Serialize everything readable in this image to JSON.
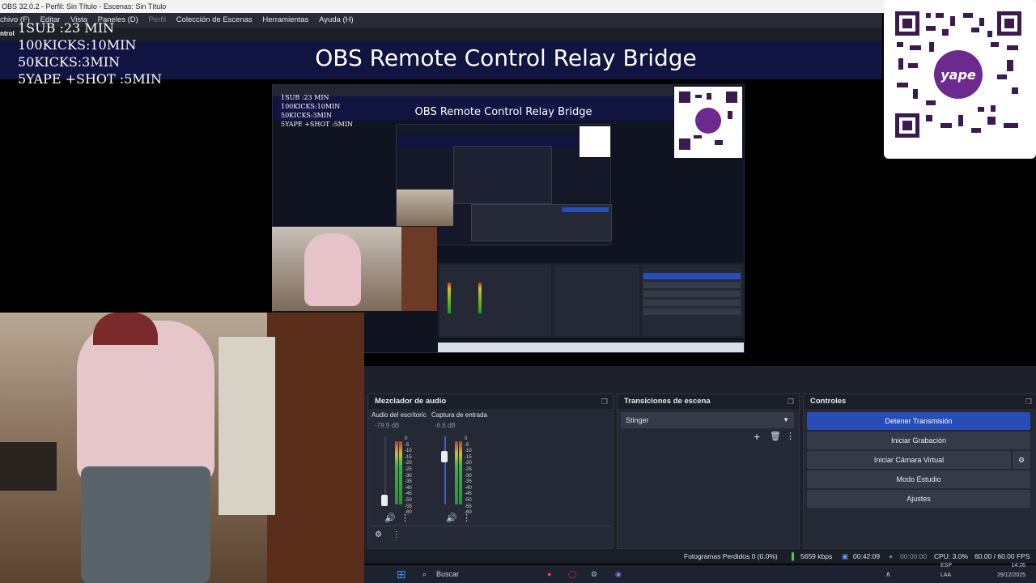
{
  "window": {
    "title": "OBS 32.0.2 - Perfil: Sin Título - Escenas: Sin Título"
  },
  "menu": {
    "items": [
      "chivo (F)",
      "Editar",
      "Vista",
      "Paneles (D)",
      "Perfil",
      "Colección de Escenas",
      "Herramientas",
      "Ayuda (H)"
    ]
  },
  "control_strip": {
    "label": "ntrol"
  },
  "overlay": {
    "banner_title": "OBS Remote Control Relay Bridge",
    "lines": [
      "1SUB :23 MIN",
      "100KICKS:10MIN",
      "50KICKS:3MIN",
      "5YAPE +SHOT :5MIN"
    ]
  },
  "qr": {
    "label": "yape"
  },
  "audio_mixer": {
    "title": "Mezclador de audio",
    "channels": [
      {
        "name": "Audio del escritoric",
        "db": "-79.9 dB",
        "level": 0.45
      },
      {
        "name": "Captura de entrada",
        "db": "-6.6 dB",
        "level": 0.8
      }
    ],
    "scale": [
      "0",
      "-5",
      "-10",
      "-15",
      "-20",
      "-25",
      "-30",
      "-35",
      "-40",
      "-45",
      "-50",
      "-55",
      "-60"
    ]
  },
  "transitions": {
    "title": "Transiciones de escena",
    "selected": "Stinger"
  },
  "controls": {
    "title": "Controles",
    "buttons": [
      "Detener Transmisión",
      "Iniciar Grabación",
      "Iniciar Cámara Virtual",
      "Modo Estudio",
      "Ajustes"
    ]
  },
  "status": {
    "dropped": "Fotogramas Perdidos 0 (0.0%)",
    "bitrate": "5659 kbps",
    "stream_time": "00:42:09",
    "rec_time": "00:00:00",
    "cpu": "CPU: 3.0%",
    "fps": "60.00 / 60.00 FPS"
  },
  "taskbar": {
    "search": "Buscar",
    "lang": "ESP",
    "lang2": "LAA",
    "time": "14:26",
    "date": "29/12/2025"
  },
  "preview": {
    "title": "OBS Remote Control Relay Bridge",
    "lines": [
      "1SUB :23 MIN",
      "100KICKS:10MIN",
      "50KICKS:3MIN",
      "5YAPE +SHOT :5MIN"
    ]
  },
  "colors": {
    "banner": "#0f1440",
    "primary_button": "#284cb8",
    "panel": "#252935"
  }
}
